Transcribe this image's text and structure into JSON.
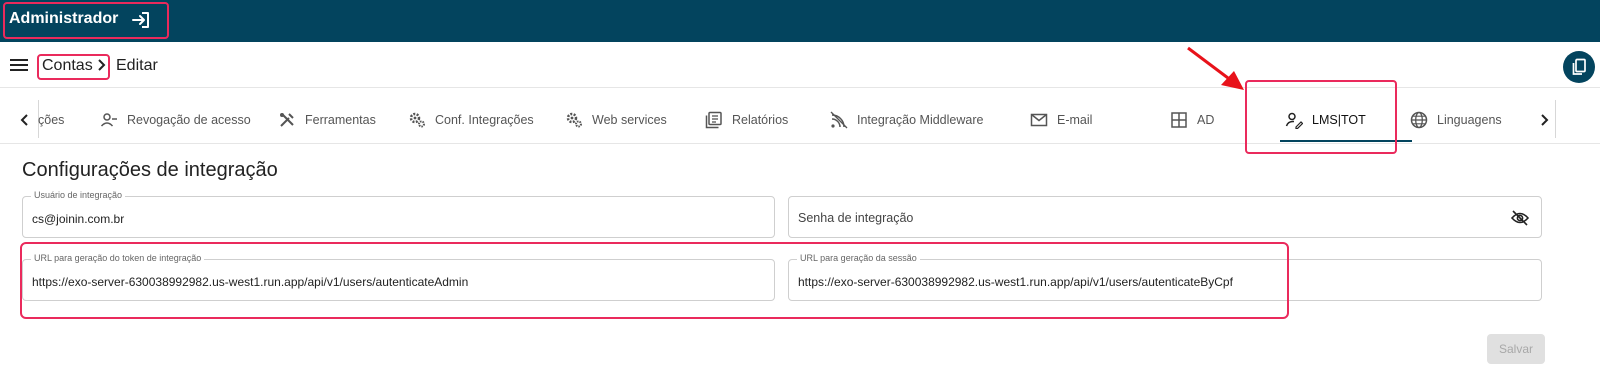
{
  "header": {
    "title": "Administrador"
  },
  "breadcrumb": {
    "parent": "Contas",
    "current": "Editar"
  },
  "tabs": [
    {
      "label": "ções",
      "icon": "partial-tab-icon"
    },
    {
      "label": "Revogação de acesso",
      "icon": "person-remove-icon"
    },
    {
      "label": "Ferramentas",
      "icon": "tools-icon"
    },
    {
      "label": "Conf. Integrações",
      "icon": "gears-icon"
    },
    {
      "label": "Web services",
      "icon": "gears-icon"
    },
    {
      "label": "Relatórios",
      "icon": "reports-icon"
    },
    {
      "label": "Integração Middleware",
      "icon": "signal-icon"
    },
    {
      "label": "E-mail",
      "icon": "mail-icon"
    },
    {
      "label": "AD",
      "icon": "grid-icon"
    },
    {
      "label": "LMS|TOT",
      "icon": "person-edit-icon",
      "active": true
    },
    {
      "label": "Linguagens",
      "icon": "globe-icon"
    }
  ],
  "section": {
    "title": "Configurações de integração"
  },
  "fields": {
    "user": {
      "label": "Usuário de integração",
      "value": "cs@joinin.com.br"
    },
    "password": {
      "placeholder": "Senha de integração"
    },
    "token_url": {
      "label": "URL para geração do token de integração",
      "value": "https://exo-server-630038992982.us-west1.run.app/api/v1/users/autenticateAdmin"
    },
    "session_url": {
      "label": "URL para geração da sessão",
      "value": "https://exo-server-630038992982.us-west1.run.app/api/v1/users/autenticateByCpf"
    }
  },
  "actions": {
    "save": "Salvar"
  },
  "colors": {
    "primary": "#03445e",
    "highlight": "#ea2a5c",
    "arrow": "#e8121a"
  }
}
